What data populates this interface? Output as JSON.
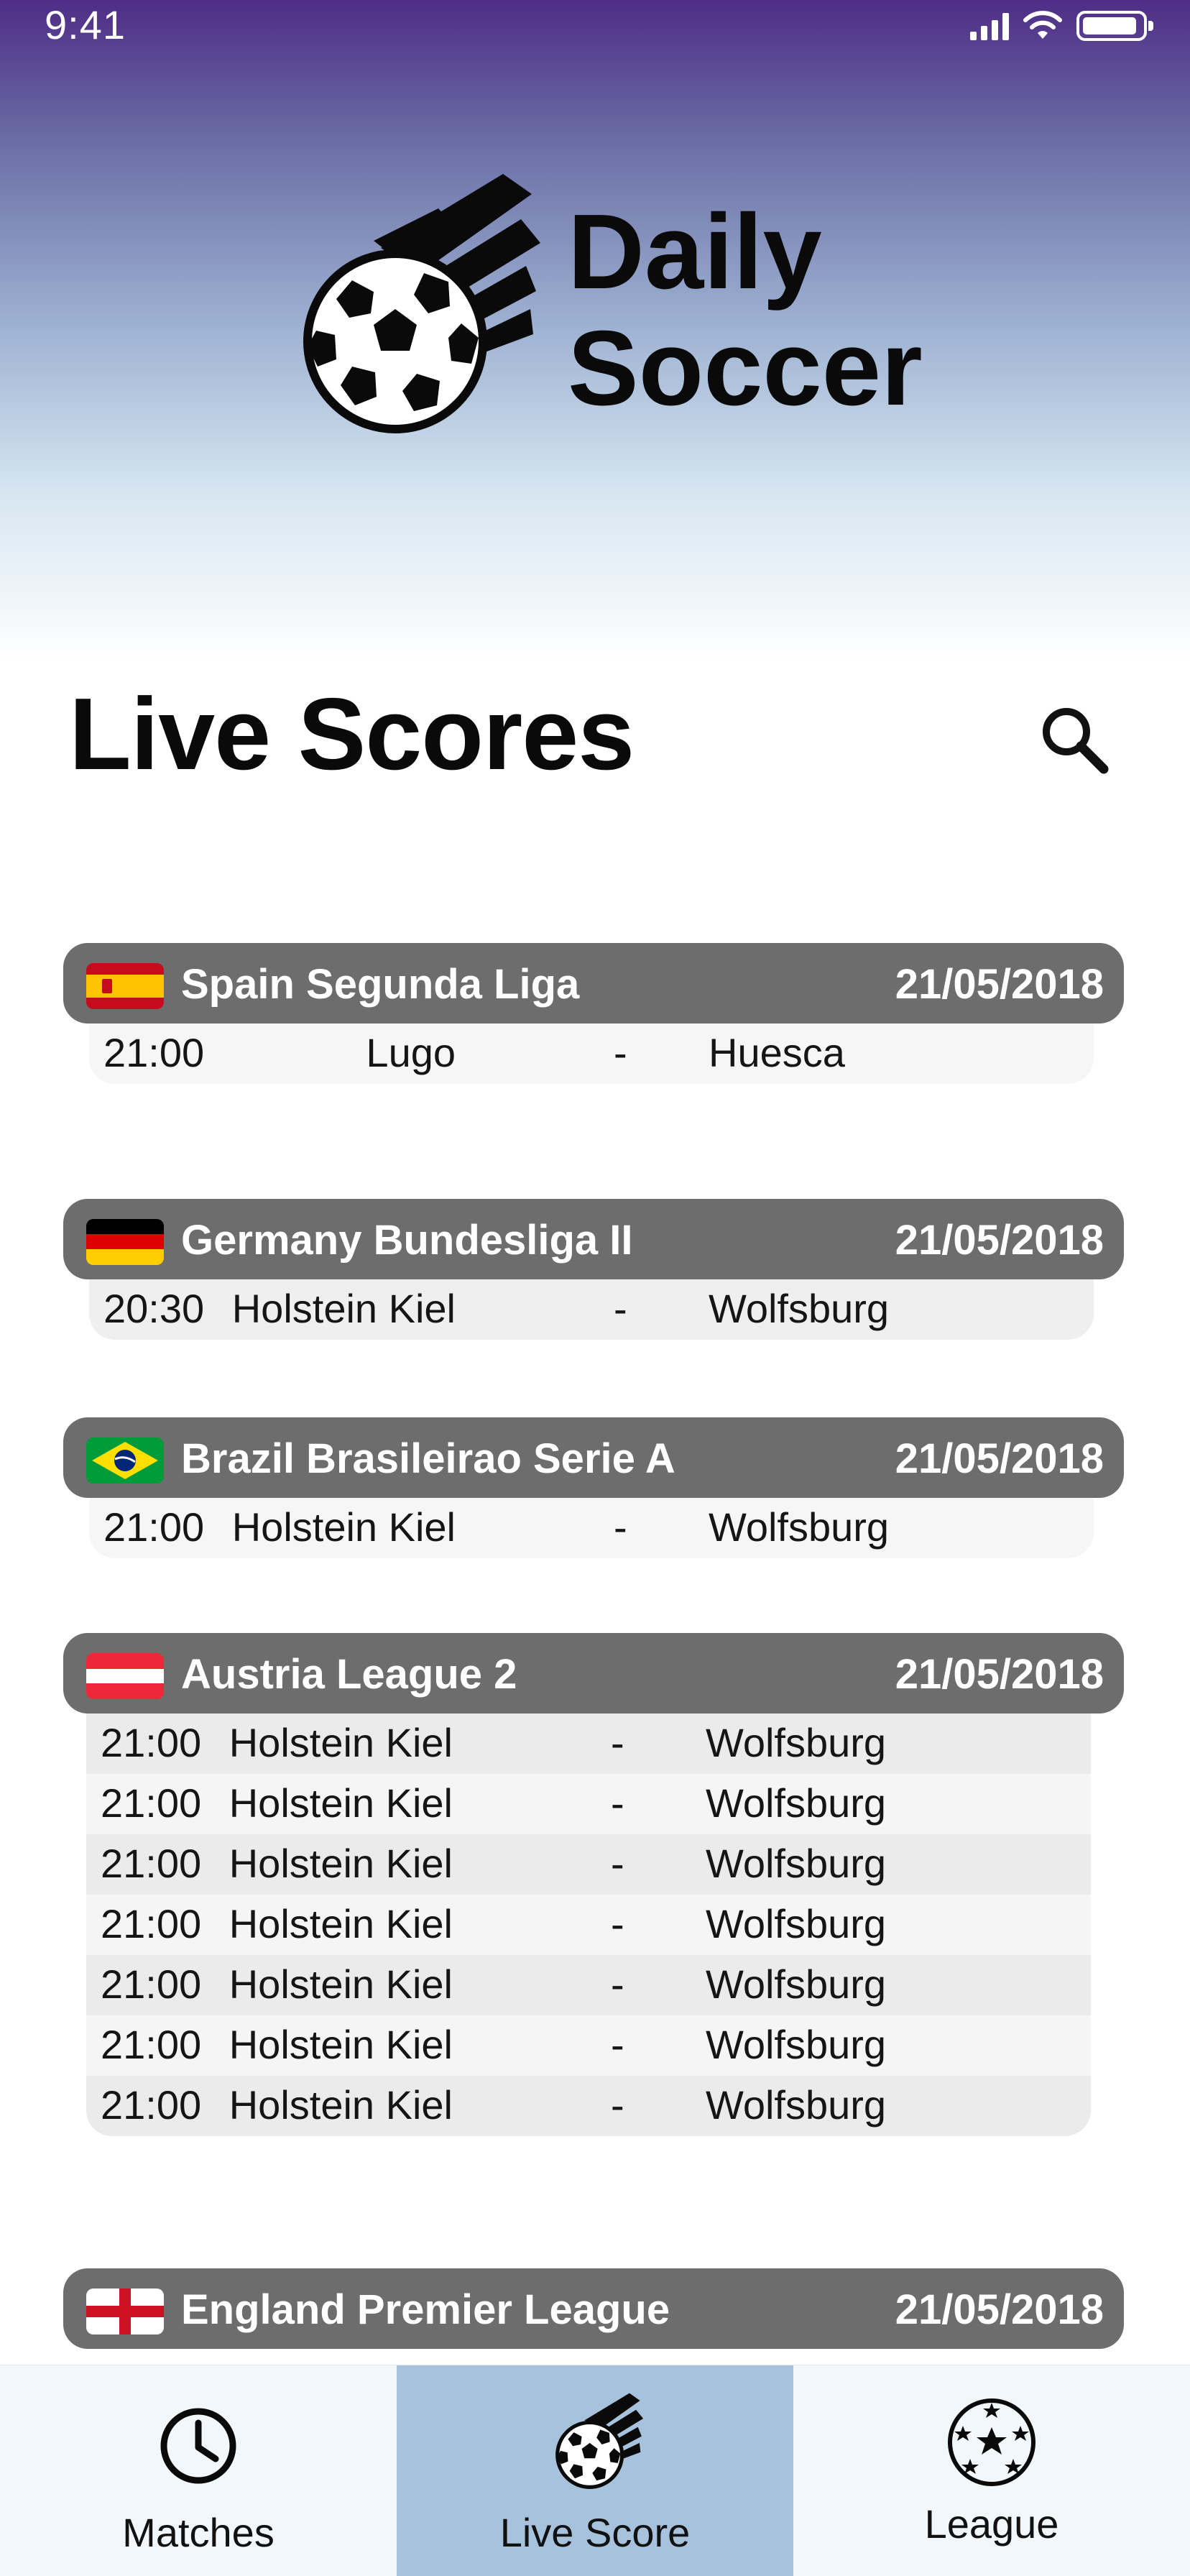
{
  "status_bar": {
    "time": "9:41"
  },
  "app": {
    "logo_line1": "Daily",
    "logo_line2": "Soccer"
  },
  "page": {
    "title": "Live Scores"
  },
  "leagues": [
    {
      "name": "Spain Segunda Liga",
      "date": "21/05/2018",
      "flag": "spain-flag",
      "matches": [
        {
          "time": "21:00",
          "home": "Lugo",
          "sep": "-",
          "away": "Huesca"
        }
      ]
    },
    {
      "name": "Germany Bundesliga II",
      "date": "21/05/2018",
      "flag": "germany-flag",
      "matches": [
        {
          "time": "20:30",
          "home": "Holstein Kiel",
          "sep": "-",
          "away": "Wolfsburg"
        }
      ]
    },
    {
      "name": "Brazil Brasileirao Serie A",
      "date": "21/05/2018",
      "flag": "brazil-flag",
      "matches": [
        {
          "time": "21:00",
          "home": "Holstein Kiel",
          "sep": "-",
          "away": "Wolfsburg"
        }
      ]
    },
    {
      "name": "Austria League 2",
      "date": "21/05/2018",
      "flag": "austria-flag",
      "matches": [
        {
          "time": "21:00",
          "home": "Holstein Kiel",
          "sep": "-",
          "away": "Wolfsburg"
        },
        {
          "time": "21:00",
          "home": "Holstein Kiel",
          "sep": "-",
          "away": "Wolfsburg"
        },
        {
          "time": "21:00",
          "home": "Holstein Kiel",
          "sep": "-",
          "away": "Wolfsburg"
        },
        {
          "time": "21:00",
          "home": "Holstein Kiel",
          "sep": "-",
          "away": "Wolfsburg"
        },
        {
          "time": "21:00",
          "home": "Holstein Kiel",
          "sep": "-",
          "away": "Wolfsburg"
        },
        {
          "time": "21:00",
          "home": "Holstein Kiel",
          "sep": "-",
          "away": "Wolfsburg"
        },
        {
          "time": "21:00",
          "home": "Holstein Kiel",
          "sep": "-",
          "away": "Wolfsburg"
        }
      ]
    },
    {
      "name": "England Premier League",
      "date": "21/05/2018",
      "flag": "england-flag",
      "matches": []
    }
  ],
  "tabs": [
    {
      "label": "Matches",
      "icon": "clock-icon",
      "active": false
    },
    {
      "label": "Live Score",
      "icon": "flying-ball-icon",
      "active": true
    },
    {
      "label": "League",
      "icon": "star-ball-icon",
      "active": false
    }
  ],
  "colors": {
    "header_gradient_top": "#4f2d87",
    "league_header": "#6d6d6d",
    "active_tab": "#a6c2dc",
    "tab_bar": "#f1f7fb"
  }
}
